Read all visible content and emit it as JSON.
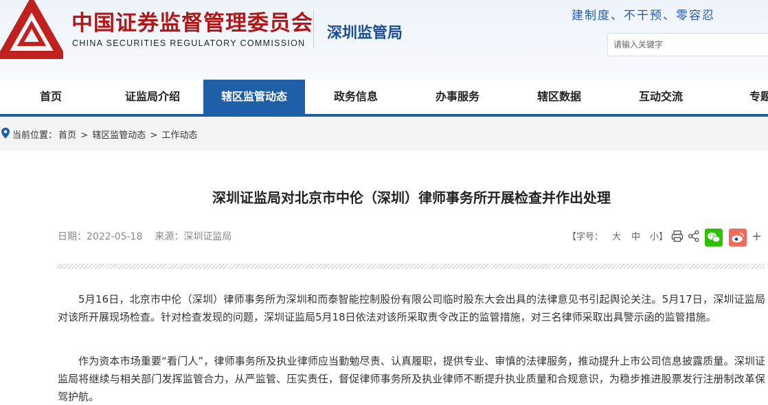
{
  "header": {
    "org_name_cn": "中国证券监督管理委员会",
    "org_name_en": "CHINA SECURITIES REGULATORY COMMISSION",
    "sub_org": "深圳监管局",
    "slogan": "建制度、不干预、零容忍",
    "search_placeholder": "请输入关键字",
    "brand_color": "#b01818"
  },
  "nav": {
    "items": [
      {
        "label": "首页"
      },
      {
        "label": "证监局介绍"
      },
      {
        "label": "辖区监管动态",
        "active": true
      },
      {
        "label": "政务信息"
      },
      {
        "label": "办事服务"
      },
      {
        "label": "辖区数据"
      },
      {
        "label": "互动交流"
      },
      {
        "label": "专题"
      }
    ],
    "active_color": "#1f5fa8"
  },
  "breadcrumb": {
    "prefix": "当前位置：",
    "items": [
      "首页",
      "辖区监管动态",
      "工作动态"
    ],
    "separator": ">"
  },
  "article": {
    "title": "深圳证监局对北京市中伦（深圳）律师事务所开展检查并作出处理",
    "date": "日期：2022-05-18",
    "source": "来源：深圳证监局",
    "paragraphs": [
      "5月16日，北京市中伦（深圳）律师事务所为深圳和而泰智能控制股份有限公司临时股东大会出具的法律意见书引起舆论关注。5月17日，深圳证监局对该所开展现场检查。针对检查发现的问题，深圳证监局5月18日依法对该所采取责令改正的监管措施，对三名律师采取出具警示函的监管措施。",
      "作为资本市场重要“看门人”，律师事务所及执业律师应当勤勉尽责、认真履职，提供专业、审慎的法律服务，推动提升上市公司信息披露质量。深圳证监局将继续与相关部门发挥监管合力，从严监管、压实责任，督促律师事务所及执业律师不断提升执业质量和合规意识，为稳步推进股票发行注册制改革保驾护航。"
    ]
  },
  "tools": {
    "font_size_label": "【字号：",
    "size_large": "大",
    "size_medium": "中",
    "size_small": "小】",
    "icons": [
      "print-icon",
      "share-icon",
      "wechat-icon",
      "weibo-icon",
      "plus-icon"
    ],
    "plus": "+"
  }
}
